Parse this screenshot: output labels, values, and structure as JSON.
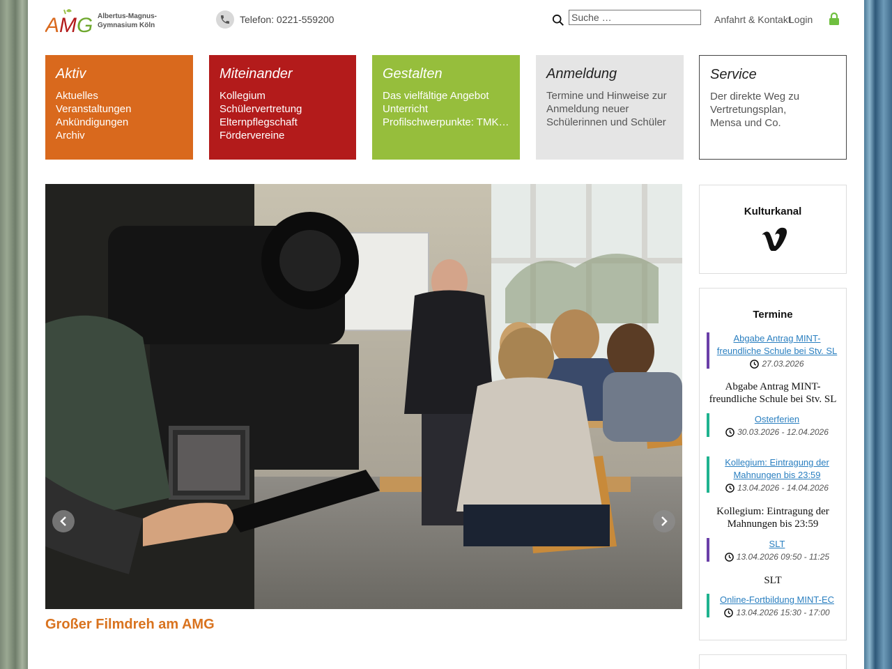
{
  "header": {
    "logo_letters": "AMG",
    "logo_line1": "Albertus-Magnus-",
    "logo_line2": "Gymnasium Köln",
    "phone": "Telefon: 0221-559200",
    "search_placeholder": "Suche …",
    "nav": {
      "contact": "Anfahrt & Kontakt",
      "login": "Login"
    }
  },
  "tiles": [
    {
      "title": "Aktiv",
      "color": "#d9691d",
      "items": [
        "Aktuelles",
        "Veranstaltungen",
        "Ankündigungen",
        "Archiv"
      ]
    },
    {
      "title": "Miteinander",
      "color": "#b31b1b",
      "items": [
        "Kollegium",
        "Schülervertretung",
        "Elternpflegschaft",
        "Fördervereine"
      ]
    },
    {
      "title": "Gestalten",
      "color": "#96be3c",
      "items": [
        "Das vielfältige Angebot",
        "Unterricht",
        "Profilschwerpunkte: TMK ..."
      ]
    },
    {
      "title": "Anmeldung",
      "color": "#e5e5e5",
      "items": [
        "Termine und Hinweise zur",
        "Anmeldung neuer",
        "Schülerinnen und Schüler"
      ]
    },
    {
      "title": "Service",
      "color": "#ffffff",
      "items": [
        "Der direkte Weg zu",
        "Vertretungsplan,",
        "Mensa und Co."
      ]
    }
  ],
  "slider": {
    "caption": "Großer Filmdreh am AMG"
  },
  "sidebar": {
    "kultur_title": "Kulturkanal",
    "kultur_icon": "vimeo-icon",
    "termine_title": "Termine",
    "events": [
      {
        "title": "Abgabe Antrag MINT-freundliche Schule bei Stv. SL",
        "date": "27.03.2026",
        "color": "#6a3fa8",
        "desc": "Abgabe Antrag MINT-freundliche Schule bei Stv. SL"
      },
      {
        "title": "Osterferien",
        "date": "30.03.2026 - 12.04.2026",
        "color": "#1fb38f",
        "desc": ""
      },
      {
        "title": "Kollegium: Eintragung der Mahnungen bis 23:59",
        "date": "13.04.2026 - 14.04.2026",
        "color": "#1fb38f",
        "desc": "Kollegium: Eintragung der Mahnungen bis 23:59"
      },
      {
        "title": "SLT",
        "date": "13.04.2026 09:50 - 11:25",
        "color": "#6a3fa8",
        "desc": "SLT"
      },
      {
        "title": "Online-Fortbildung MINT-EC",
        "date": "13.04.2026 15:30 - 17:00",
        "color": "#1fb38f",
        "desc": ""
      }
    ]
  }
}
